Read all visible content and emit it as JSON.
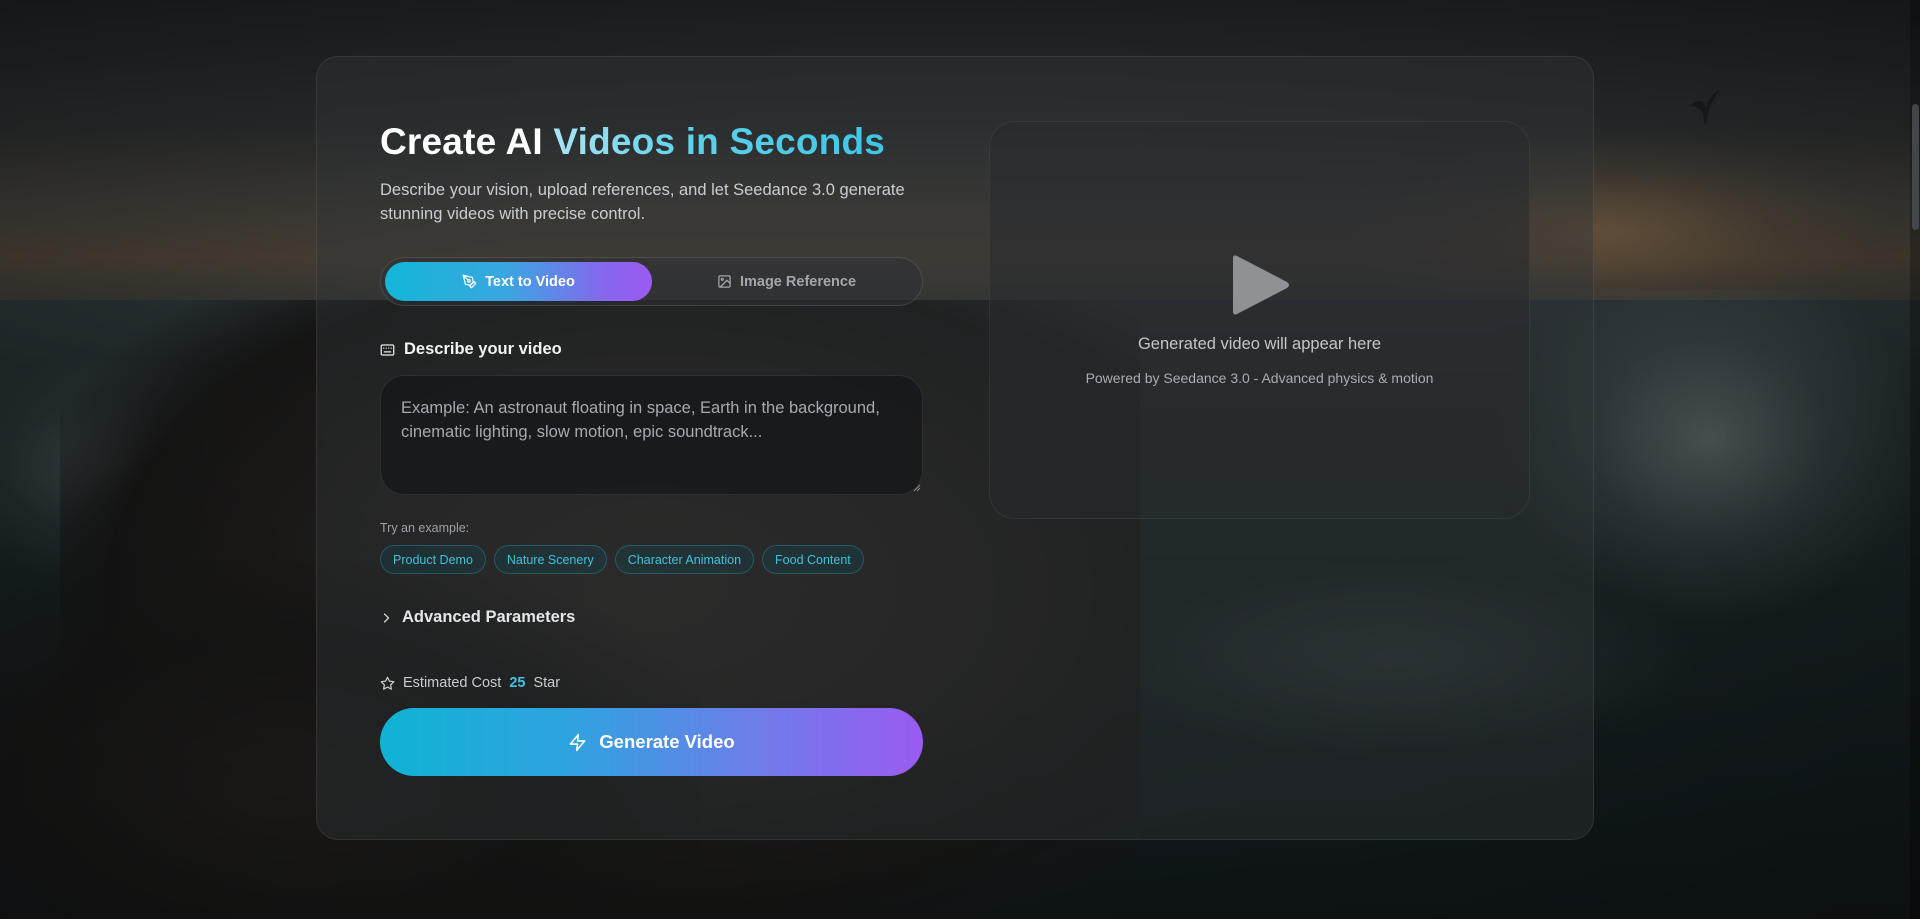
{
  "hero": {
    "title_part1": "Create AI ",
    "title_part2": "Videos in Seconds",
    "subtitle": "Describe your vision, upload references, and let Seedance 3.0 generate stunning videos with precise control."
  },
  "mode_tabs": [
    {
      "label": "Text to Video",
      "icon": "pen-tool-icon",
      "active": true
    },
    {
      "label": "Image Reference",
      "icon": "image-icon",
      "active": false
    }
  ],
  "prompt": {
    "section_label": "Describe your video",
    "section_icon": "keyboard-icon",
    "value": "",
    "placeholder": "Example: An astronaut floating in space, Earth in the background, cinematic lighting, slow motion, epic soundtrack..."
  },
  "examples": {
    "label": "Try an example:",
    "chips": [
      "Product Demo",
      "Nature Scenery",
      "Character Animation",
      "Food Content"
    ]
  },
  "advanced": {
    "label": "Advanced Parameters",
    "icon": "chevron-right-icon",
    "expanded": false
  },
  "cost": {
    "label": "Estimated Cost",
    "value": "25",
    "unit": "Star",
    "icon": "star-icon"
  },
  "generate": {
    "label": "Generate Video",
    "icon": "zap-icon"
  },
  "preview": {
    "title": "Generated video will appear here",
    "subtitle": "Powered by Seedance 3.0 - Advanced physics & motion",
    "icon": "play-icon"
  },
  "colors": {
    "accent_cyan": "#3ec6e6",
    "gradient_start": "#0fb3d6",
    "gradient_end": "#9a5bf1"
  }
}
